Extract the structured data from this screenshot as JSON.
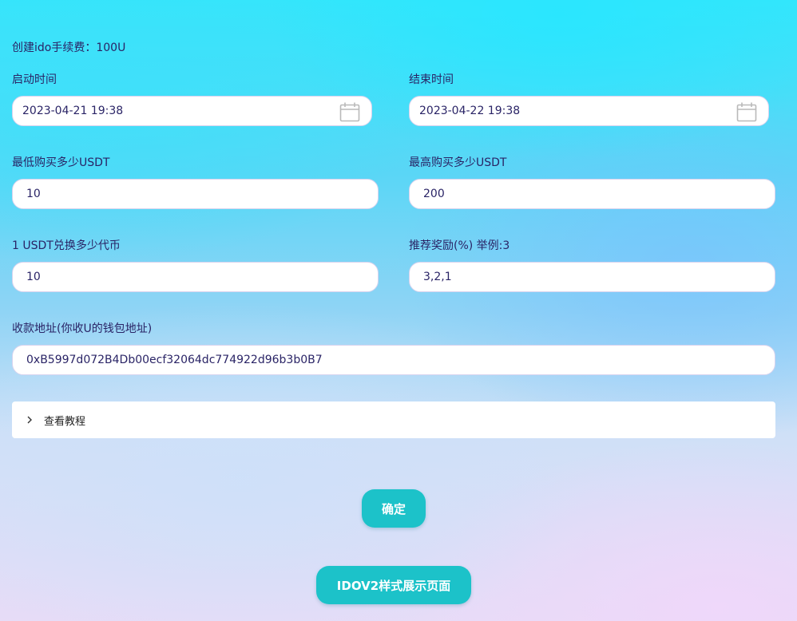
{
  "fee_line": "创建ido手续费：100U",
  "start": {
    "label": "启动时间",
    "value": "2023-04-21 19:38"
  },
  "end": {
    "label": "结束时间",
    "value": "2023-04-22 19:38"
  },
  "min_buy": {
    "label": "最低购买多少USDT",
    "value": "10"
  },
  "max_buy": {
    "label": "最高购买多少USDT",
    "value": "200"
  },
  "rate": {
    "label": "1 USDT兑换多少代币",
    "value": "10"
  },
  "referral": {
    "label": "推荐奖励(%) 举例:3",
    "value": "3,2,1"
  },
  "address": {
    "label": "收款地址(你收U的钱包地址)",
    "value": "0xB5997d072B4Db00ecf32064dc774922d96b3b0B7"
  },
  "tutorial": {
    "label": "查看教程",
    "icon": "chevron-right-icon"
  },
  "confirm_button": "确定",
  "idov2_button": "IDOV2样式展示页面",
  "colors": {
    "button": "#1cc2c9",
    "text": "#2a2466",
    "input_border": "#d7d3ee"
  }
}
